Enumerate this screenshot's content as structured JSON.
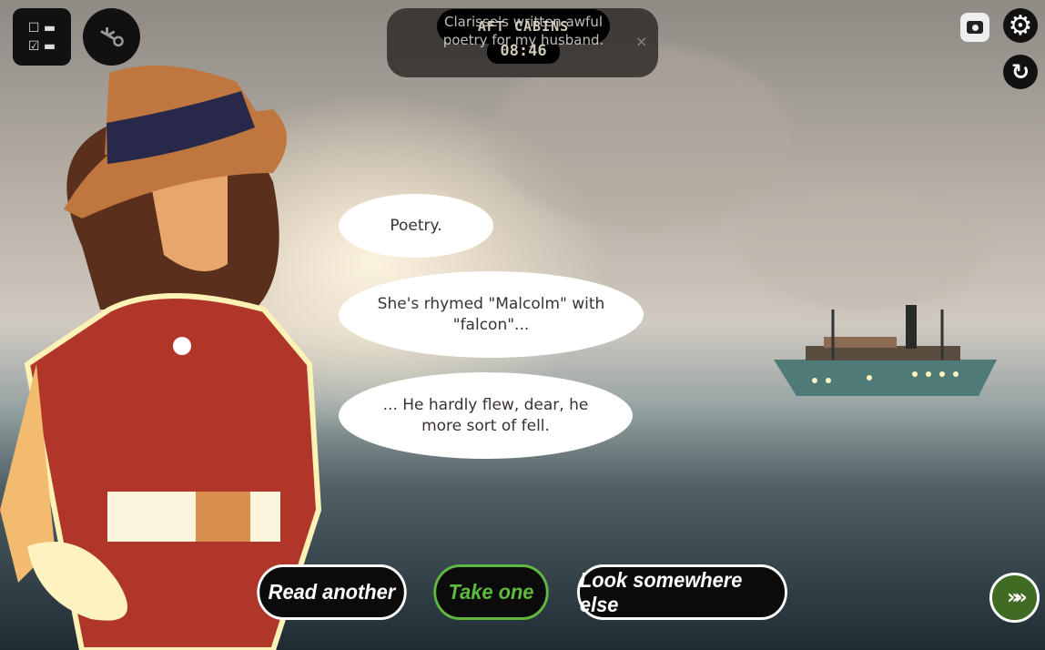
{
  "hud": {
    "location": "AFT CABINS",
    "time": "08:46"
  },
  "notification": {
    "text": "Clarisse's written awful poetry for my husband.",
    "close": "×"
  },
  "dialogue": [
    {
      "text": "Poetry."
    },
    {
      "text": "She's rhymed \"Malcolm\" with \"falcon\"..."
    },
    {
      "text": "... He hardly flew, dear, he more sort of fell."
    }
  ],
  "choices": [
    {
      "label": "Read another",
      "highlighted": false
    },
    {
      "label": "Take one",
      "highlighted": true
    },
    {
      "label": "Look somewhere else",
      "highlighted": false
    }
  ],
  "icons": {
    "checklist": "checklist-icon",
    "key": "key-icon",
    "camera": "camera-icon",
    "settings": "gear-icon",
    "restart": "restart-icon",
    "skip": "fast-forward-icon"
  },
  "colors": {
    "accent": "#5fb83f",
    "skip_button": "#3f6b22"
  }
}
